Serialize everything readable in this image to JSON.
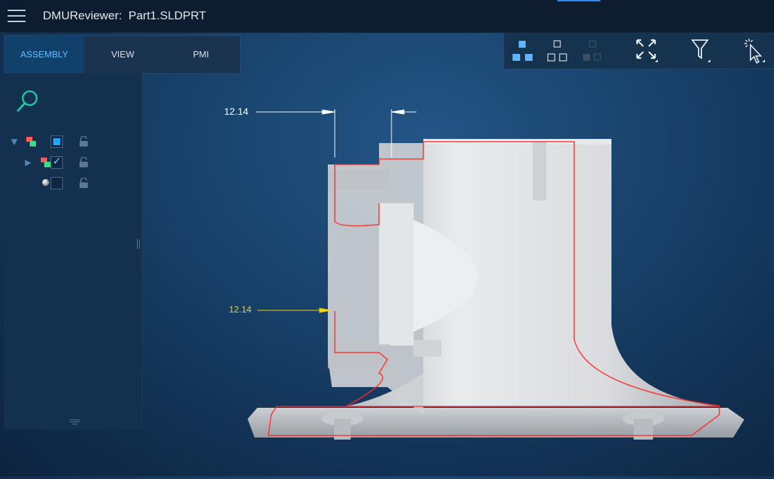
{
  "window": {
    "app_name": "DMUReviewer:",
    "file_name": "Part1.SLDPRT"
  },
  "tabs": [
    {
      "label": "ASSEMBLY",
      "active": true
    },
    {
      "label": "VIEW",
      "active": false
    },
    {
      "label": "PMI",
      "active": false
    }
  ],
  "toolbar": {
    "buttons": [
      {
        "name": "display-mode-filled",
        "icon": "four-squares-filled-icon"
      },
      {
        "name": "display-mode-outline",
        "icon": "four-squares-outline-icon"
      },
      {
        "name": "display-mode-dim",
        "icon": "four-squares-dim-icon"
      },
      {
        "name": "fit-all",
        "icon": "expand-arrows-icon"
      },
      {
        "name": "filter",
        "icon": "funnel-icon"
      },
      {
        "name": "select",
        "icon": "cursor-select-icon"
      }
    ]
  },
  "tree": {
    "rows": [
      {
        "level": 0,
        "expanded": true,
        "state": "partial"
      },
      {
        "level": 1,
        "expanded": false,
        "state": "checked"
      },
      {
        "level": 2,
        "state": "unchecked"
      }
    ]
  },
  "dimensions": [
    {
      "value": "12.14",
      "color": "#ffffff"
    },
    {
      "value": "12.14",
      "color": "#f5d20a"
    }
  ],
  "colors": {
    "accent": "#5fc0ff",
    "section_edge": "#ff2a2a",
    "dimension_selected": "#f5d20a",
    "check_fill": "#1ea7ff"
  }
}
